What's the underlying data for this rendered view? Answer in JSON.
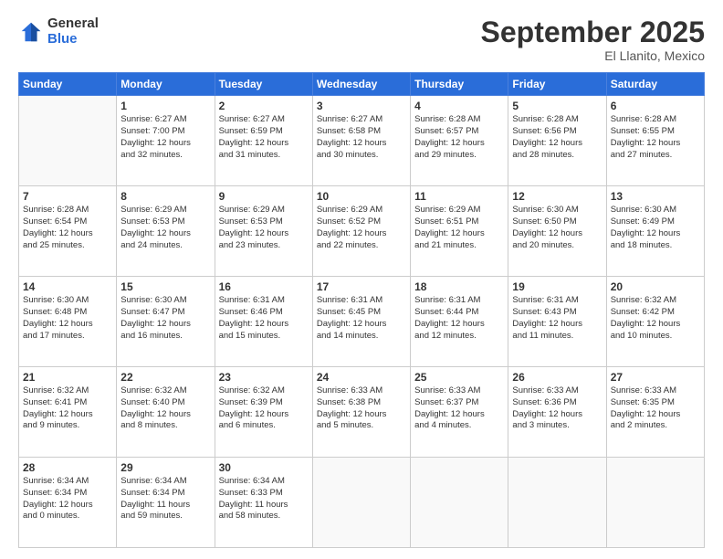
{
  "logo": {
    "general": "General",
    "blue": "Blue"
  },
  "header": {
    "month": "September 2025",
    "location": "El Llanito, Mexico"
  },
  "days_of_week": [
    "Sunday",
    "Monday",
    "Tuesday",
    "Wednesday",
    "Thursday",
    "Friday",
    "Saturday"
  ],
  "weeks": [
    [
      {
        "day": "",
        "info": ""
      },
      {
        "day": "1",
        "info": "Sunrise: 6:27 AM\nSunset: 7:00 PM\nDaylight: 12 hours\nand 32 minutes."
      },
      {
        "day": "2",
        "info": "Sunrise: 6:27 AM\nSunset: 6:59 PM\nDaylight: 12 hours\nand 31 minutes."
      },
      {
        "day": "3",
        "info": "Sunrise: 6:27 AM\nSunset: 6:58 PM\nDaylight: 12 hours\nand 30 minutes."
      },
      {
        "day": "4",
        "info": "Sunrise: 6:28 AM\nSunset: 6:57 PM\nDaylight: 12 hours\nand 29 minutes."
      },
      {
        "day": "5",
        "info": "Sunrise: 6:28 AM\nSunset: 6:56 PM\nDaylight: 12 hours\nand 28 minutes."
      },
      {
        "day": "6",
        "info": "Sunrise: 6:28 AM\nSunset: 6:55 PM\nDaylight: 12 hours\nand 27 minutes."
      }
    ],
    [
      {
        "day": "7",
        "info": "Sunrise: 6:28 AM\nSunset: 6:54 PM\nDaylight: 12 hours\nand 25 minutes."
      },
      {
        "day": "8",
        "info": "Sunrise: 6:29 AM\nSunset: 6:53 PM\nDaylight: 12 hours\nand 24 minutes."
      },
      {
        "day": "9",
        "info": "Sunrise: 6:29 AM\nSunset: 6:53 PM\nDaylight: 12 hours\nand 23 minutes."
      },
      {
        "day": "10",
        "info": "Sunrise: 6:29 AM\nSunset: 6:52 PM\nDaylight: 12 hours\nand 22 minutes."
      },
      {
        "day": "11",
        "info": "Sunrise: 6:29 AM\nSunset: 6:51 PM\nDaylight: 12 hours\nand 21 minutes."
      },
      {
        "day": "12",
        "info": "Sunrise: 6:30 AM\nSunset: 6:50 PM\nDaylight: 12 hours\nand 20 minutes."
      },
      {
        "day": "13",
        "info": "Sunrise: 6:30 AM\nSunset: 6:49 PM\nDaylight: 12 hours\nand 18 minutes."
      }
    ],
    [
      {
        "day": "14",
        "info": "Sunrise: 6:30 AM\nSunset: 6:48 PM\nDaylight: 12 hours\nand 17 minutes."
      },
      {
        "day": "15",
        "info": "Sunrise: 6:30 AM\nSunset: 6:47 PM\nDaylight: 12 hours\nand 16 minutes."
      },
      {
        "day": "16",
        "info": "Sunrise: 6:31 AM\nSunset: 6:46 PM\nDaylight: 12 hours\nand 15 minutes."
      },
      {
        "day": "17",
        "info": "Sunrise: 6:31 AM\nSunset: 6:45 PM\nDaylight: 12 hours\nand 14 minutes."
      },
      {
        "day": "18",
        "info": "Sunrise: 6:31 AM\nSunset: 6:44 PM\nDaylight: 12 hours\nand 12 minutes."
      },
      {
        "day": "19",
        "info": "Sunrise: 6:31 AM\nSunset: 6:43 PM\nDaylight: 12 hours\nand 11 minutes."
      },
      {
        "day": "20",
        "info": "Sunrise: 6:32 AM\nSunset: 6:42 PM\nDaylight: 12 hours\nand 10 minutes."
      }
    ],
    [
      {
        "day": "21",
        "info": "Sunrise: 6:32 AM\nSunset: 6:41 PM\nDaylight: 12 hours\nand 9 minutes."
      },
      {
        "day": "22",
        "info": "Sunrise: 6:32 AM\nSunset: 6:40 PM\nDaylight: 12 hours\nand 8 minutes."
      },
      {
        "day": "23",
        "info": "Sunrise: 6:32 AM\nSunset: 6:39 PM\nDaylight: 12 hours\nand 6 minutes."
      },
      {
        "day": "24",
        "info": "Sunrise: 6:33 AM\nSunset: 6:38 PM\nDaylight: 12 hours\nand 5 minutes."
      },
      {
        "day": "25",
        "info": "Sunrise: 6:33 AM\nSunset: 6:37 PM\nDaylight: 12 hours\nand 4 minutes."
      },
      {
        "day": "26",
        "info": "Sunrise: 6:33 AM\nSunset: 6:36 PM\nDaylight: 12 hours\nand 3 minutes."
      },
      {
        "day": "27",
        "info": "Sunrise: 6:33 AM\nSunset: 6:35 PM\nDaylight: 12 hours\nand 2 minutes."
      }
    ],
    [
      {
        "day": "28",
        "info": "Sunrise: 6:34 AM\nSunset: 6:34 PM\nDaylight: 12 hours\nand 0 minutes."
      },
      {
        "day": "29",
        "info": "Sunrise: 6:34 AM\nSunset: 6:34 PM\nDaylight: 11 hours\nand 59 minutes."
      },
      {
        "day": "30",
        "info": "Sunrise: 6:34 AM\nSunset: 6:33 PM\nDaylight: 11 hours\nand 58 minutes."
      },
      {
        "day": "",
        "info": ""
      },
      {
        "day": "",
        "info": ""
      },
      {
        "day": "",
        "info": ""
      },
      {
        "day": "",
        "info": ""
      }
    ]
  ]
}
